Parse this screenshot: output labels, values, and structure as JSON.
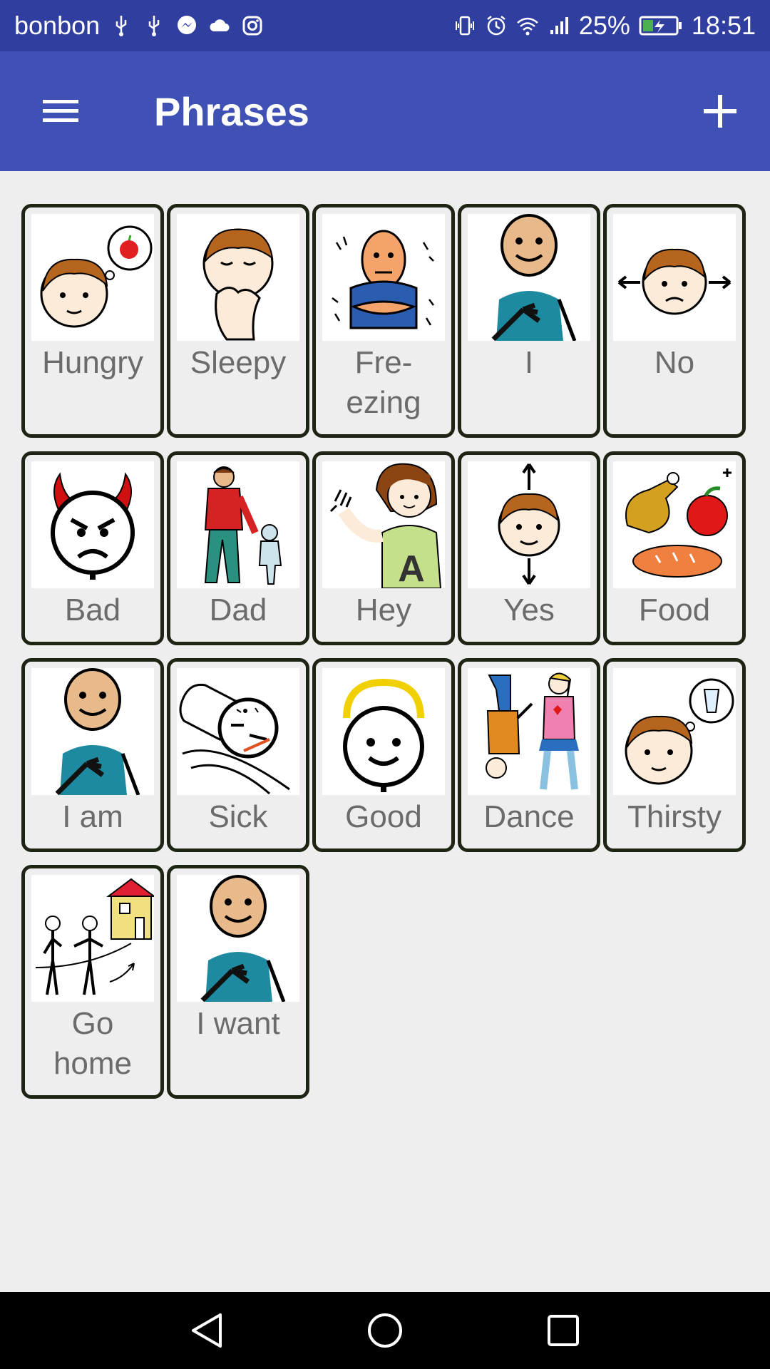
{
  "status_bar": {
    "carrier": "bonbon",
    "battery": "25%",
    "time": "18:51",
    "icons_left": [
      "usb-icon",
      "usb-icon",
      "messenger-icon",
      "cloud-icon",
      "instagram-icon"
    ],
    "icons_right": [
      "vibrate-icon",
      "alarm-icon",
      "wifi-icon",
      "signal-icon",
      "battery-icon"
    ]
  },
  "app_bar": {
    "title": "Phrases",
    "menu_icon": "hamburger-menu-icon",
    "add_icon": "plus-icon",
    "color": "#3f51b5",
    "status_color": "#303f9f"
  },
  "tiles": [
    {
      "label": "Hungry",
      "icon": "hungry-boy-apple-icon"
    },
    {
      "label": "Sleepy",
      "icon": "sleepy-yawn-icon"
    },
    {
      "label": "Fre-\nezing",
      "icon": "freezing-person-icon"
    },
    {
      "label": "I",
      "icon": "self-pointing-person-icon"
    },
    {
      "label": "No",
      "icon": "head-shake-no-icon"
    },
    {
      "label": "Bad",
      "icon": "devil-face-icon"
    },
    {
      "label": "Dad",
      "icon": "father-child-icon"
    },
    {
      "label": "Hey",
      "icon": "waving-girl-icon"
    },
    {
      "label": "Yes",
      "icon": "head-nod-yes-icon"
    },
    {
      "label": "Food",
      "icon": "food-icon"
    },
    {
      "label": "I am",
      "icon": "self-pointing-person-icon"
    },
    {
      "label": "Sick",
      "icon": "sick-thermometer-icon"
    },
    {
      "label": "Good",
      "icon": "halo-face-icon"
    },
    {
      "label": "Dance",
      "icon": "dancing-people-icon"
    },
    {
      "label": "Thirsty",
      "icon": "thirsty-boy-glass-icon"
    },
    {
      "label": "Go\nhome",
      "icon": "go-home-icon"
    },
    {
      "label": "I want",
      "icon": "self-pointing-person-icon"
    }
  ],
  "nav_bar": {
    "back_icon": "back-triangle-icon",
    "home_icon": "home-circle-icon",
    "recents_icon": "recents-square-icon"
  }
}
